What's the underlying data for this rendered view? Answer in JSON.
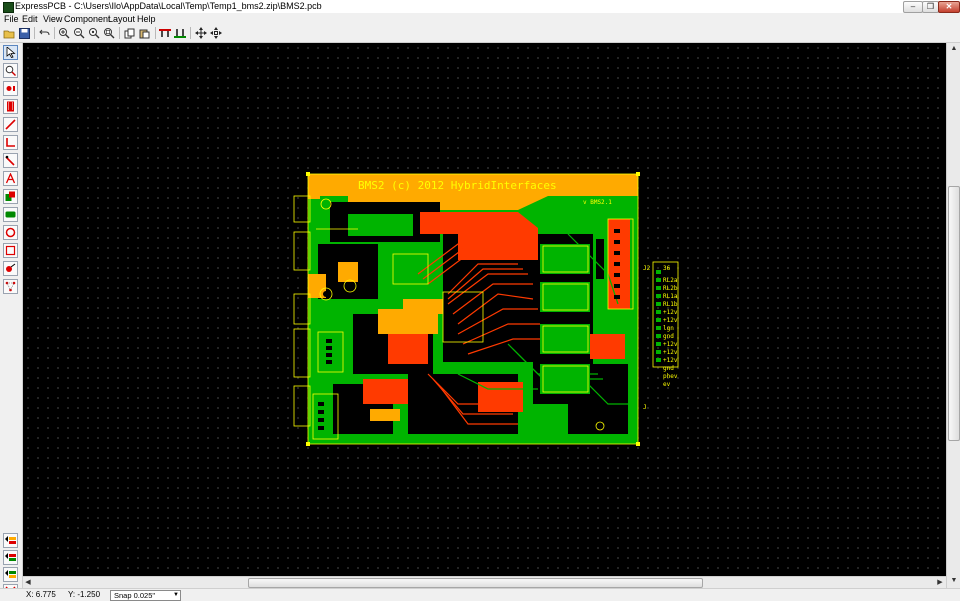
{
  "window": {
    "title": "ExpressPCB - C:\\Users\\Ilo\\AppData\\Local\\Temp\\Temp1_bms2.zip\\BMS2.pcb",
    "minimize": "–",
    "restore": "❒",
    "close": "✕"
  },
  "menu": [
    "File",
    "Edit",
    "View",
    "Component",
    "Layout",
    "Help"
  ],
  "toolbar": {
    "icons": [
      "open-icon",
      "save-icon",
      "undo-icon",
      "zoom-in-icon",
      "zoom-out-icon",
      "zoom-previous-icon",
      "zoom-fit-icon",
      "copy-icon",
      "paste-icon",
      "top-layer-icon",
      "bottom-layer-icon",
      "move-icon",
      "pan-icon"
    ]
  },
  "left_tools": {
    "icons": [
      "pointer-icon",
      "zoom-tool-icon",
      "pad-icon",
      "component-icon",
      "trace-icon",
      "trace-corner-icon",
      "diagonal-trace-icon",
      "text-icon",
      "filled-rect-icon",
      "filled-area-icon",
      "circle-icon",
      "rectangle-icon",
      "pin-icon",
      "netlist-icon"
    ],
    "layer_icons": [
      "top-copper-layer-icon",
      "bottom-copper-layer-icon",
      "silkscreen-layer-icon",
      "board-outline-layer-icon"
    ]
  },
  "board": {
    "title": "BMS2 (c) 2012 HybridInterfaces",
    "version": "v BMS2.1",
    "labels": [
      "J2",
      "36",
      "RL2a",
      "RL2b",
      "RL1a",
      "RL1b",
      "+12v",
      "+12v",
      "lgn",
      "gnd",
      "+12v",
      "+12v",
      "+12v",
      "gnd",
      "phev",
      "ev",
      "J"
    ]
  },
  "colors": {
    "canvas": "#000000",
    "grid_dot": "#3c3c3c",
    "top_copper": "#ff3a00",
    "bottom_copper": "#00b400",
    "silkscreen": "#ffff00",
    "fill_orange": "#ffaa00"
  },
  "status": {
    "x": "X: 6.775",
    "y": "Y: -1.250",
    "snap": "Snap  0.025\""
  }
}
